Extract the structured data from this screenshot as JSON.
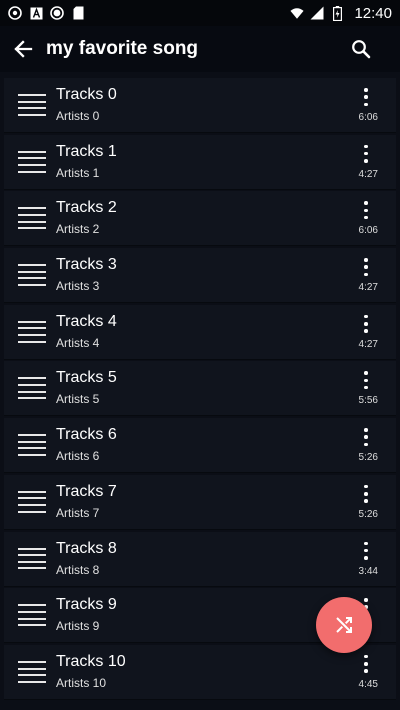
{
  "status_bar": {
    "time": "12:40",
    "icons": [
      "app-icon",
      "app-a-icon",
      "record-icon",
      "sd-card-icon",
      "wifi-icon",
      "signal-icon",
      "battery-charging-icon"
    ]
  },
  "toolbar": {
    "title": "my favorite song",
    "back_icon": "arrow-left-icon",
    "search_icon": "search-icon"
  },
  "tracks": [
    {
      "title": "Tracks 0",
      "artist": "Artists 0",
      "duration": "6:06"
    },
    {
      "title": "Tracks 1",
      "artist": "Artists 1",
      "duration": "4:27"
    },
    {
      "title": "Tracks 2",
      "artist": "Artists 2",
      "duration": "6:06"
    },
    {
      "title": "Tracks 3",
      "artist": "Artists 3",
      "duration": "4:27"
    },
    {
      "title": "Tracks 4",
      "artist": "Artists 4",
      "duration": "4:27"
    },
    {
      "title": "Tracks 5",
      "artist": "Artists 5",
      "duration": "5:56"
    },
    {
      "title": "Tracks 6",
      "artist": "Artists 6",
      "duration": "5:26"
    },
    {
      "title": "Tracks 7",
      "artist": "Artists 7",
      "duration": "5:26"
    },
    {
      "title": "Tracks 8",
      "artist": "Artists 8",
      "duration": "3:44"
    },
    {
      "title": "Tracks 9",
      "artist": "Artists 9",
      "duration": ""
    },
    {
      "title": "Tracks 10",
      "artist": "Artists 10",
      "duration": "4:45"
    }
  ],
  "fab": {
    "icon": "shuffle-icon",
    "color": "#f26d6d"
  },
  "colors": {
    "background": "#0b0e16",
    "row": "#10141d",
    "accent": "#f26d6d"
  }
}
